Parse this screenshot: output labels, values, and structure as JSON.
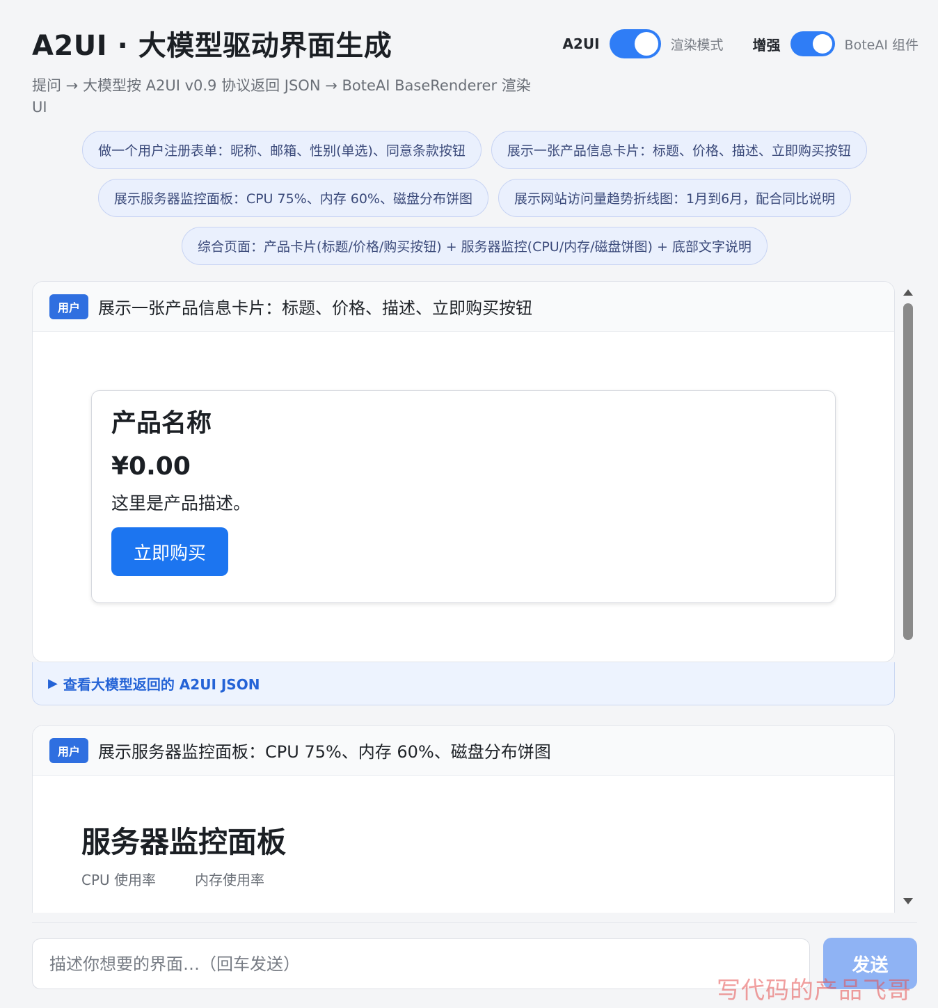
{
  "header": {
    "title": "A2UI · 大模型驱动界面生成",
    "subtitle": "提问 → 大模型按 A2UI v0.9 协议返回 JSON → BoteAI BaseRenderer 渲染 UI"
  },
  "toggles": [
    {
      "label": "A2UI",
      "desc": "渲染模式",
      "on": true
    },
    {
      "label": "增强",
      "desc": "BoteAI 组件",
      "on": true
    }
  ],
  "chips": [
    "做一个用户注册表单：昵称、邮箱、性别(单选)、同意条款按钮",
    "展示一张产品信息卡片：标题、价格、描述、立即购买按钮",
    "展示服务器监控面板：CPU 75%、内存 60%、磁盘分布饼图",
    "展示网站访问量趋势折线图：1月到6月，配合同比说明",
    "综合页面：产品卡片(标题/价格/购买按钮) + 服务器监控(CPU/内存/磁盘饼图) + 底部文字说明"
  ],
  "messages": [
    {
      "badge": "用户",
      "prompt": "展示一张产品信息卡片：标题、价格、描述、立即购买按钮",
      "card": {
        "name": "产品名称",
        "price": "¥0.00",
        "description": "这里是产品描述。",
        "button": "立即购买"
      },
      "json_toggle": "查看大模型返回的 A2UI JSON"
    },
    {
      "badge": "用户",
      "prompt": "展示服务器监控面板：CPU 75%、内存 60%、磁盘分布饼图",
      "panel": {
        "title": "服务器监控面板",
        "labels": [
          "CPU 使用率",
          "内存使用率"
        ]
      }
    }
  ],
  "composer": {
    "placeholder": "描述你想要的界面…（回车发送）",
    "send": "发送"
  },
  "watermark": "写代码的产品飞哥"
}
